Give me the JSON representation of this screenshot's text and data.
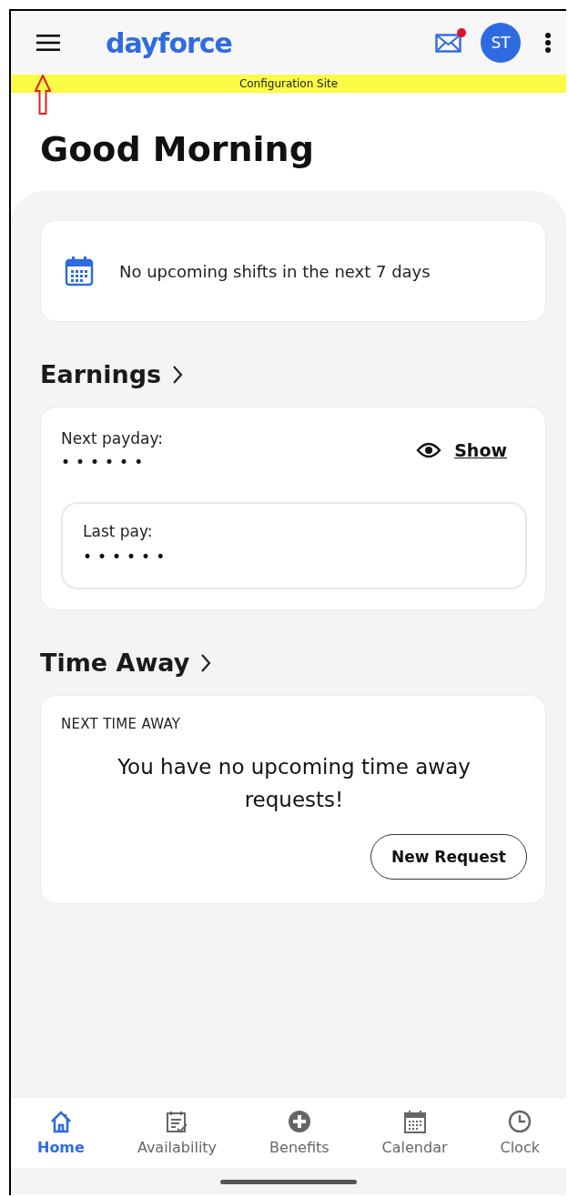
{
  "header": {
    "logo": "dayforce",
    "has_unread": true,
    "avatar_initials": "ST"
  },
  "banner": "Configuration Site",
  "greeting": "Good Morning",
  "shifts": {
    "message": "No upcoming shifts in the next 7 days"
  },
  "earnings": {
    "title": "Earnings",
    "next_label": "Next payday:",
    "next_value": "••••••",
    "show_label": "Show",
    "last_label": "Last pay:",
    "last_value": "••••••"
  },
  "time_away": {
    "title": "Time Away",
    "caption": "NEXT TIME AWAY",
    "message": "You have no upcoming time away requests!",
    "button": "New Request"
  },
  "nav": [
    {
      "label": "Home",
      "kind": "home",
      "selected": true
    },
    {
      "label": "Availability",
      "kind": "availability",
      "selected": false
    },
    {
      "label": "Benefits",
      "kind": "benefits",
      "selected": false
    },
    {
      "label": "Calendar",
      "kind": "calendar",
      "selected": false
    },
    {
      "label": "Clock",
      "kind": "clock",
      "selected": false
    }
  ]
}
